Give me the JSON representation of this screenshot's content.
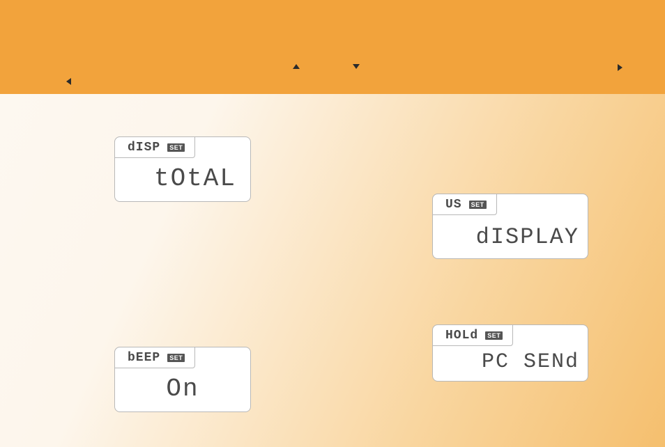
{
  "panels": {
    "disp": {
      "tab": "dISP",
      "badge": "SET",
      "value": "tOtAL"
    },
    "beep": {
      "tab": "bEEP",
      "badge": "SET",
      "value": "On"
    },
    "us": {
      "tab": "US",
      "badge": "SET",
      "value": "dISPLAY"
    },
    "hold": {
      "tab": "HOLd",
      "badge": "SET",
      "value": "PC SENd"
    }
  }
}
